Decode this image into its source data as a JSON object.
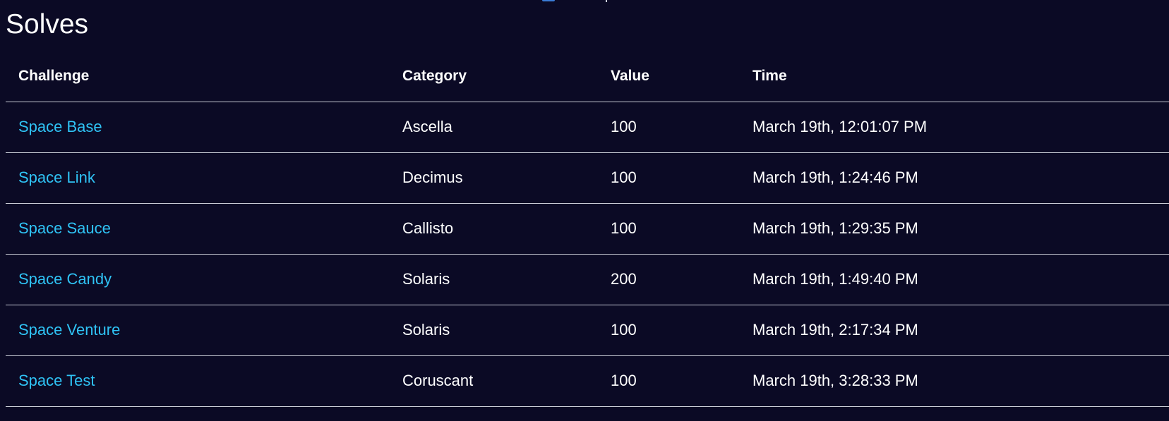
{
  "page": {
    "title": "Solves"
  },
  "colors": {
    "background": "#0b0a25",
    "text": "#ffffff",
    "link": "#2fc3f5",
    "divider": "#c9ccd6"
  },
  "table": {
    "headers": {
      "challenge": "Challenge",
      "category": "Category",
      "value": "Value",
      "time": "Time"
    },
    "rows": [
      {
        "challenge": "Space Base",
        "category": "Ascella",
        "value": "100",
        "time": "March 19th, 12:01:07 PM"
      },
      {
        "challenge": "Space Link",
        "category": "Decimus",
        "value": "100",
        "time": "March 19th, 1:24:46 PM"
      },
      {
        "challenge": "Space Sauce",
        "category": "Callisto",
        "value": "100",
        "time": "March 19th, 1:29:35 PM"
      },
      {
        "challenge": "Space Candy",
        "category": "Solaris",
        "value": "200",
        "time": "March 19th, 1:49:40 PM"
      },
      {
        "challenge": "Space Venture",
        "category": "Solaris",
        "value": "100",
        "time": "March 19th, 2:17:34 PM"
      },
      {
        "challenge": "Space Test",
        "category": "Coruscant",
        "value": "100",
        "time": "March 19th, 3:28:33 PM"
      }
    ]
  }
}
